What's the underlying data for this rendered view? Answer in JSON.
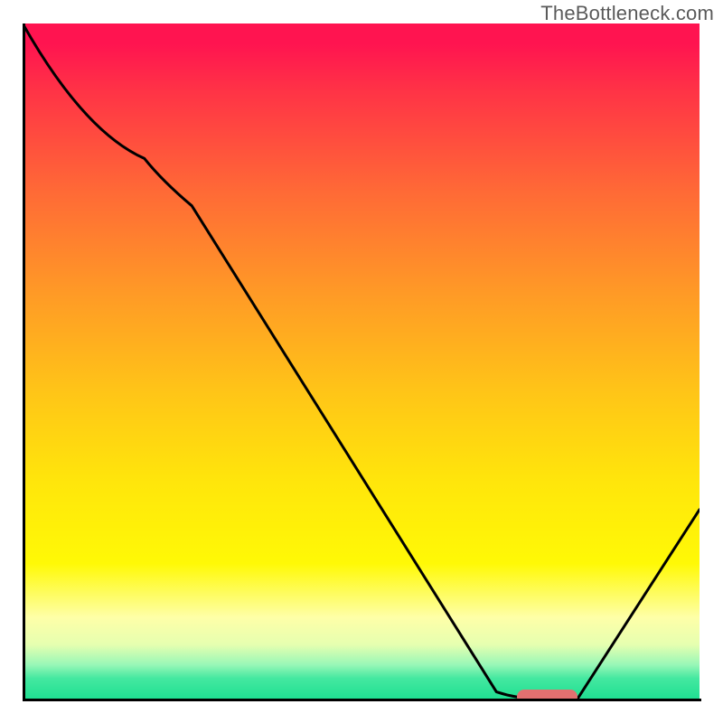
{
  "attribution": "TheBottleneck.com",
  "chart_data": {
    "type": "line",
    "title": "",
    "xlabel": "",
    "ylabel": "",
    "xlim": [
      0,
      100
    ],
    "ylim": [
      0,
      100
    ],
    "series": [
      {
        "name": "curve",
        "x": [
          0,
          18,
          25,
          70,
          76,
          82,
          100
        ],
        "y": [
          100,
          80,
          73,
          1,
          0,
          0,
          28
        ]
      }
    ],
    "optimal_band": {
      "x_start": 73,
      "x_end": 82,
      "y": 0
    },
    "background": "heat-gradient-red-to-green"
  }
}
